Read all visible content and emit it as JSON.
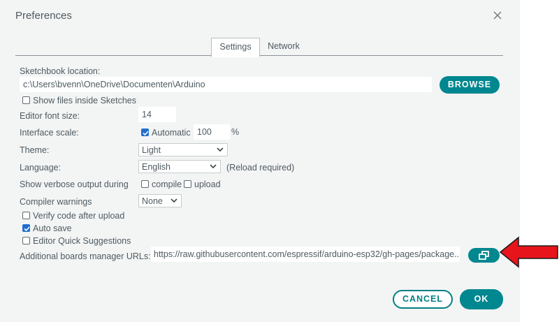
{
  "dialog": {
    "title": "Preferences",
    "tabs": [
      {
        "label": "Settings",
        "active": true
      },
      {
        "label": "Network",
        "active": false
      }
    ]
  },
  "settings": {
    "sketchbook_label": "Sketchbook location:",
    "sketchbook_path": "c:\\Users\\bvenn\\OneDrive\\Documenten\\Arduino",
    "browse_label": "BROWSE",
    "show_files_label": "Show files inside Sketches",
    "show_files_checked": false,
    "font_size_label": "Editor font size:",
    "font_size_value": "14",
    "interface_scale_label": "Interface scale:",
    "automatic_label": "Automatic",
    "automatic_checked": true,
    "scale_value": "100",
    "scale_unit": "%",
    "theme_label": "Theme:",
    "theme_value": "Light",
    "language_label": "Language:",
    "language_value": "English",
    "language_note": "(Reload required)",
    "verbose_label": "Show verbose output during",
    "compile_label": "compile",
    "compile_checked": false,
    "upload_label": "upload",
    "upload_checked": false,
    "compiler_warnings_label": "Compiler warnings",
    "compiler_warnings_value": "None",
    "verify_label": "Verify code after upload",
    "verify_checked": false,
    "autosave_label": "Auto save",
    "autosave_checked": true,
    "quick_suggestions_label": "Editor Quick Suggestions",
    "quick_suggestions_checked": false,
    "boards_urls_label": "Additional boards manager URLs:",
    "boards_urls_value": "https://raw.githubusercontent.com/espressif/arduino-esp32/gh-pages/package..."
  },
  "footer": {
    "cancel_label": "CANCEL",
    "ok_label": "OK"
  },
  "colors": {
    "accent": "#00878f",
    "annotation_arrow": "#e8141b"
  },
  "icons": [
    "close-icon",
    "chevron-down-icon",
    "open-window-icon",
    "checkmark-icon",
    "red-arrow-annotation"
  ]
}
